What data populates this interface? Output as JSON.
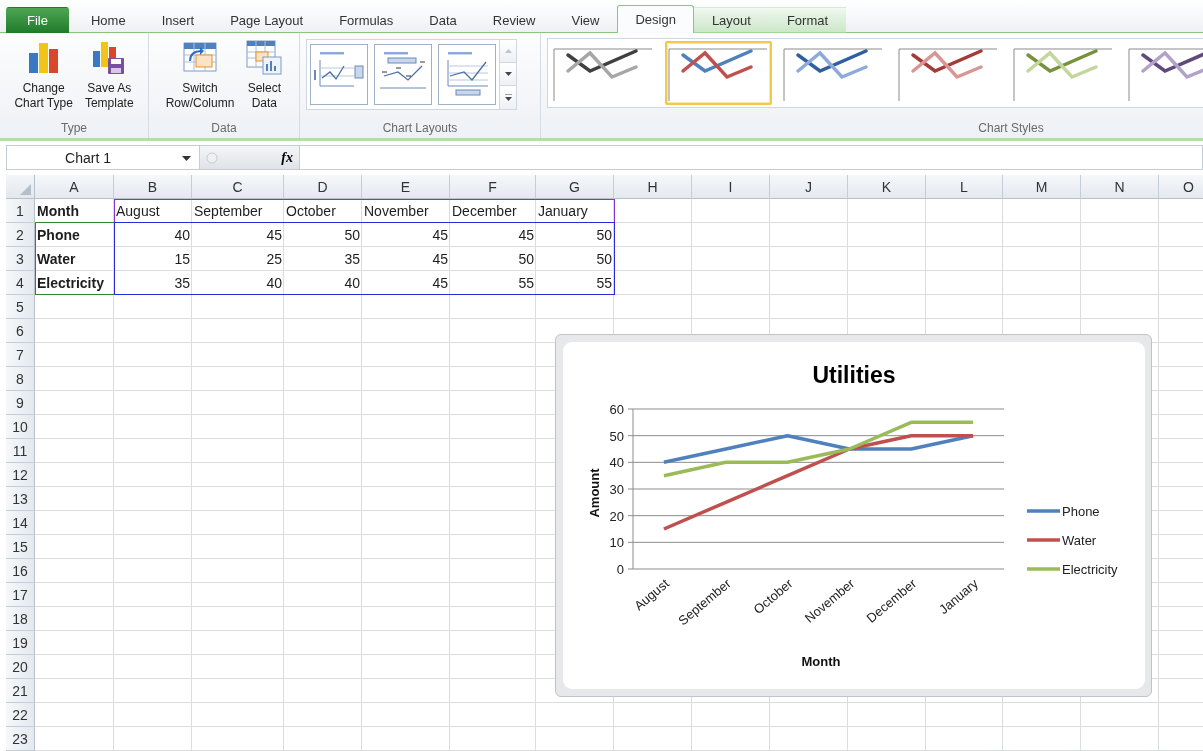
{
  "ribbon_tabs": [
    {
      "label": "File",
      "kind": "file",
      "selected": false
    },
    {
      "label": "Home",
      "kind": "normal",
      "selected": false
    },
    {
      "label": "Insert",
      "kind": "normal",
      "selected": false
    },
    {
      "label": "Page Layout",
      "kind": "normal",
      "selected": false
    },
    {
      "label": "Formulas",
      "kind": "normal",
      "selected": false
    },
    {
      "label": "Data",
      "kind": "normal",
      "selected": false
    },
    {
      "label": "Review",
      "kind": "normal",
      "selected": false
    },
    {
      "label": "View",
      "kind": "normal",
      "selected": false
    },
    {
      "label": "Design",
      "kind": "contextual",
      "selected": true
    },
    {
      "label": "Layout",
      "kind": "contextual",
      "selected": false
    },
    {
      "label": "Format",
      "kind": "contextual",
      "selected": false
    }
  ],
  "ribbon_groups": [
    {
      "label": "Type",
      "kind": "buttons",
      "buttons": [
        {
          "label": "Change\nChart Type",
          "kind": "change_type"
        },
        {
          "label": "Save As\nTemplate",
          "kind": "save_template"
        }
      ]
    },
    {
      "label": "Data",
      "kind": "buttons",
      "buttons": [
        {
          "label": "Switch\nRow/Column",
          "kind": "switch"
        },
        {
          "label": "Select\nData",
          "kind": "select_data"
        }
      ]
    },
    {
      "label": "Chart Layouts",
      "kind": "layouts",
      "layouts": [
        {
          "kind": "legend_right"
        },
        {
          "kind": "data_labels"
        },
        {
          "kind": "legend_bottom"
        }
      ]
    },
    {
      "label": "Chart Styles",
      "kind": "styles",
      "styles": [
        {
          "selected": false,
          "kind": "gray"
        },
        {
          "selected": true,
          "kind": "colorful"
        },
        {
          "selected": false,
          "kind": "blue"
        },
        {
          "selected": false,
          "kind": "red"
        },
        {
          "selected": false,
          "kind": "green"
        },
        {
          "selected": false,
          "kind": "purple"
        }
      ]
    }
  ],
  "formula_bar": {
    "name_box": "Chart 1",
    "function_button": "fx"
  },
  "sheet": {
    "columns": [
      "A",
      "B",
      "C",
      "D",
      "E",
      "F",
      "G",
      "H",
      "I",
      "J",
      "K",
      "L",
      "M",
      "N",
      "O"
    ],
    "rows": [
      {
        "number": "1",
        "cells": [
          "Month",
          "August",
          "September",
          "October",
          "November",
          "December",
          "January"
        ]
      },
      {
        "number": "2",
        "cells": [
          "Phone",
          "40",
          "45",
          "50",
          "45",
          "45",
          "50"
        ]
      },
      {
        "number": "3",
        "cells": [
          "Water",
          "15",
          "25",
          "35",
          "45",
          "50",
          "50"
        ]
      },
      {
        "number": "4",
        "cells": [
          "Electricity",
          "35",
          "40",
          "40",
          "45",
          "55",
          "55"
        ]
      },
      {
        "number": "5"
      },
      {
        "number": "6"
      },
      {
        "number": "7"
      },
      {
        "number": "8"
      },
      {
        "number": "9"
      },
      {
        "number": "10"
      },
      {
        "number": "11"
      },
      {
        "number": "12"
      },
      {
        "number": "13"
      },
      {
        "number": "14"
      },
      {
        "number": "15"
      },
      {
        "number": "16"
      },
      {
        "number": "17"
      },
      {
        "number": "18"
      },
      {
        "number": "19"
      },
      {
        "number": "20"
      },
      {
        "number": "21"
      },
      {
        "number": "22"
      },
      {
        "number": "23"
      }
    ]
  },
  "chart": {
    "chart_data": {
      "type": "line",
      "title": "Utilities",
      "xlabel": "Month",
      "ylabel": "Amount",
      "categories": [
        "August",
        "September",
        "October",
        "November",
        "December",
        "January"
      ],
      "series": [
        {
          "name": "Phone",
          "color": "#4f81bd",
          "values": [
            40,
            45,
            50,
            45,
            45,
            50
          ]
        },
        {
          "name": "Water",
          "color": "#c0504d",
          "values": [
            15,
            25,
            35,
            45,
            50,
            50
          ]
        },
        {
          "name": "Electricity",
          "color": "#9bbb59",
          "values": [
            35,
            40,
            40,
            45,
            55,
            55
          ]
        }
      ],
      "ylim": [
        0,
        60
      ],
      "yticks": [
        {
          "value": 0,
          "label": "0"
        },
        {
          "value": 10,
          "label": "10"
        },
        {
          "value": 20,
          "label": "20"
        },
        {
          "value": 30,
          "label": "30"
        },
        {
          "value": 40,
          "label": "40"
        },
        {
          "value": 50,
          "label": "50"
        },
        {
          "value": 60,
          "label": "60"
        }
      ],
      "grid": "y",
      "legend": true
    }
  }
}
